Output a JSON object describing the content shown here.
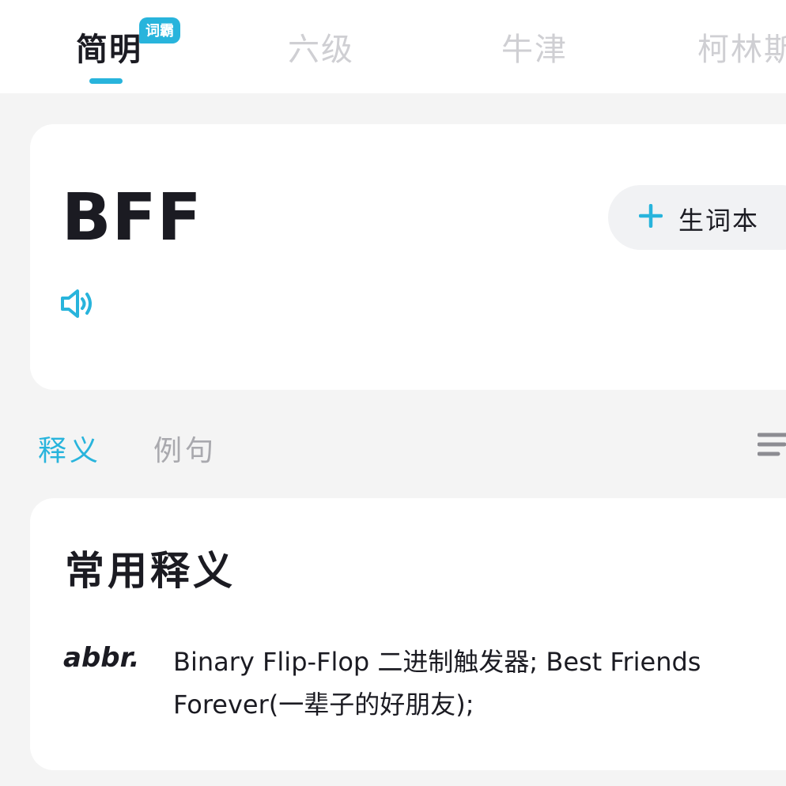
{
  "tabs": [
    {
      "label": "简明",
      "active": true
    },
    {
      "label": "六级",
      "active": false
    },
    {
      "label": "牛津",
      "active": false
    },
    {
      "label": "柯林斯",
      "active": false
    }
  ],
  "badge": "词霸",
  "word": {
    "headword": "BFF",
    "add_label": "生词本"
  },
  "section_tabs": [
    {
      "label": "释义",
      "active": true
    },
    {
      "label": "例句",
      "active": false
    }
  ],
  "definition": {
    "title": "常用释义",
    "pos": "abbr.",
    "text": "Binary Flip-Flop 二进制触发器; Best Friends Forever(一辈子的好朋友);"
  },
  "colors": {
    "accent": "#28b4dc",
    "text": "#1b1b22",
    "inactive": "#cfcfd3",
    "background": "#f4f4f4"
  },
  "icons": [
    "speaker-icon",
    "plus-icon",
    "menu-icon"
  ]
}
